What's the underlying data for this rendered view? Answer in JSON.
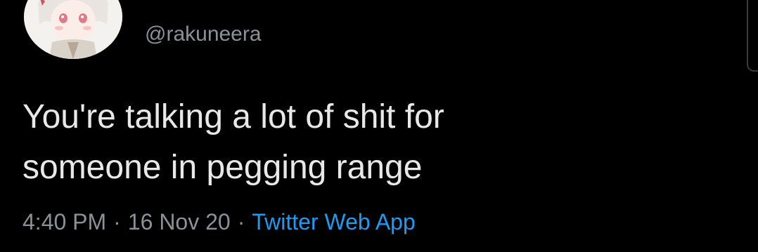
{
  "tweet": {
    "handle": "@rakuneera",
    "text_lines": [
      "You're talking a lot of shit for",
      "someone in pegging range"
    ],
    "time": "4:40 PM",
    "date": "16 Nov 20",
    "separator": "·",
    "source": "Twitter Web App"
  },
  "colors": {
    "background": "#000000",
    "text": "#e8e8e8",
    "muted": "#8b9196",
    "link": "#1d9bf0"
  },
  "icons": {
    "avatar": "anime-avatar-image"
  }
}
